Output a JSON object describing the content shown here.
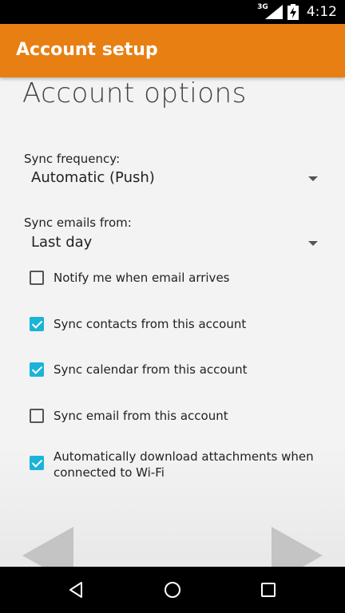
{
  "status_bar": {
    "network_label": "3G",
    "time": "4:12",
    "icons": [
      "signal-icon",
      "battery-charging-icon"
    ]
  },
  "app_bar": {
    "title": "Account setup",
    "color": "#e87f12"
  },
  "page": {
    "heading": "Account options",
    "sync_frequency": {
      "label": "Sync frequency:",
      "value": "Automatic (Push)"
    },
    "sync_emails_from": {
      "label": "Sync emails from:",
      "value": "Last day"
    },
    "options": [
      {
        "label": "Notify me when email arrives",
        "checked": false
      },
      {
        "label": "Sync contacts from this account",
        "checked": true
      },
      {
        "label": "Sync calendar from this account",
        "checked": true
      },
      {
        "label": "Sync email from this account",
        "checked": false
      },
      {
        "label": "Automatically download attachments when connected to Wi-Fi",
        "checked": true
      }
    ]
  },
  "colors": {
    "checkbox_checked": "#1ab4d8",
    "nav_arrow": "#c4c4c4"
  },
  "nav_bar": {
    "icons": [
      "back-icon",
      "home-icon",
      "recents-icon"
    ]
  }
}
